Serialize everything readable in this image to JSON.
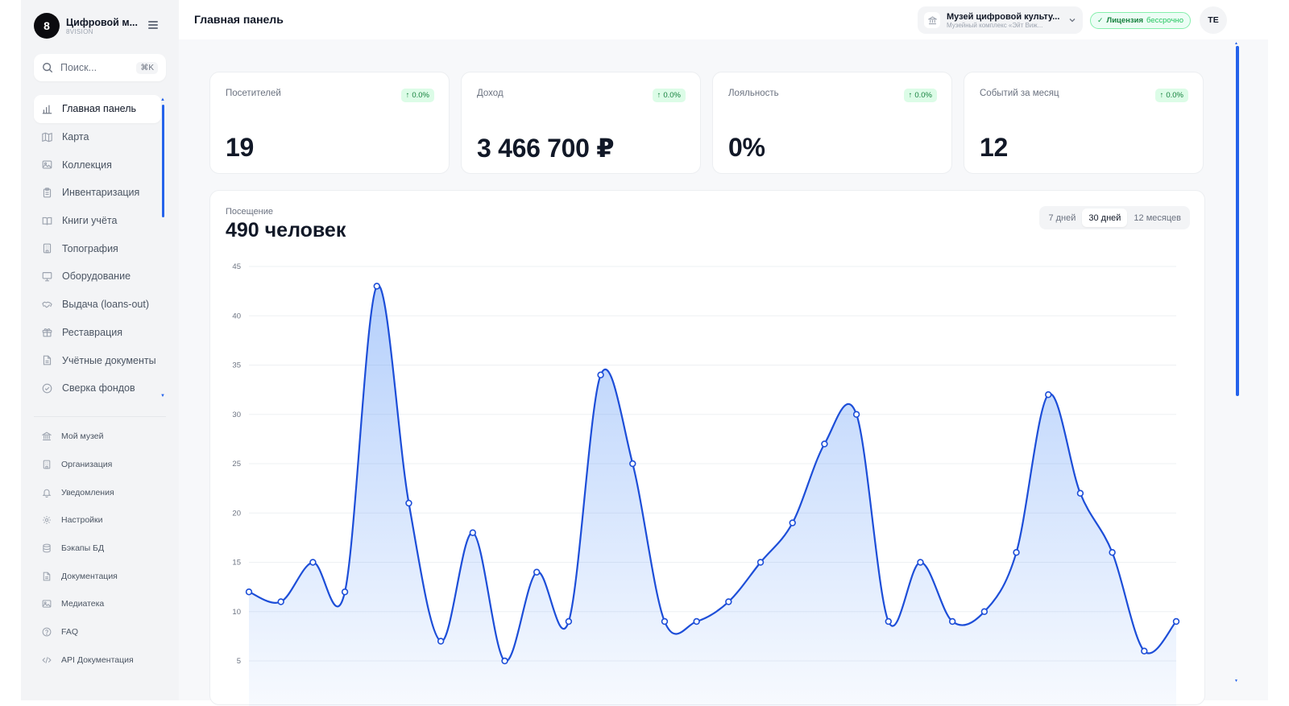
{
  "brand": {
    "logo": "8",
    "name": "Цифровой м...",
    "sub": "8VISION"
  },
  "search": {
    "placeholder": "Поиск...",
    "shortcut": "⌘K"
  },
  "nav": {
    "items": [
      {
        "label": "Главная панель",
        "icon": "bar-chart-icon",
        "active": true
      },
      {
        "label": "Карта",
        "icon": "map-icon"
      },
      {
        "label": "Коллекция",
        "icon": "image-icon"
      },
      {
        "label": "Инвентаризация",
        "icon": "clipboard-icon"
      },
      {
        "label": "Книги учёта",
        "icon": "book-icon"
      },
      {
        "label": "Топография",
        "icon": "building-icon"
      },
      {
        "label": "Оборудование",
        "icon": "monitor-icon"
      },
      {
        "label": "Выдача (loans-out)",
        "icon": "handshake-icon"
      },
      {
        "label": "Реставрация",
        "icon": "gift-icon"
      },
      {
        "label": "Учётные документы",
        "icon": "file-icon"
      },
      {
        "label": "Сверка фондов",
        "icon": "check-circle-icon"
      }
    ],
    "secondary": [
      {
        "label": "Мой музей",
        "icon": "museum-icon"
      },
      {
        "label": "Организация",
        "icon": "building-icon"
      },
      {
        "label": "Уведомления",
        "icon": "bell-icon"
      },
      {
        "label": "Настройки",
        "icon": "gear-icon"
      },
      {
        "label": "Бэкапы БД",
        "icon": "database-icon"
      },
      {
        "label": "Документация",
        "icon": "file-icon"
      },
      {
        "label": "Медиатека",
        "icon": "image-icon"
      },
      {
        "label": "FAQ",
        "icon": "help-circle-icon"
      },
      {
        "label": "API Документация",
        "icon": "code-icon"
      }
    ]
  },
  "header": {
    "title": "Главная панель",
    "museum_name": "Музей цифровой культу...",
    "museum_sub": "Музейный комплекс «Эйт Виж...",
    "license_label": "Лицензия",
    "license_term": "бессрочно",
    "avatar": "TE"
  },
  "stats": [
    {
      "label": "Посетителей",
      "change": "0.0%",
      "value": "19"
    },
    {
      "label": "Доход",
      "change": "0.0%",
      "value": "3 466 700 ₽"
    },
    {
      "label": "Лояльность",
      "change": "0.0%",
      "value": "0%"
    },
    {
      "label": "Событий за месяц",
      "change": "0.0%",
      "value": "12"
    }
  ],
  "visits": {
    "label": "Посещение",
    "total": "490 человек",
    "ranges": [
      "7 дней",
      "30 дней",
      "12 месяцев"
    ],
    "active_range": "30 дней"
  },
  "colors": {
    "accent": "#2563eb",
    "line": "#1d4ed8",
    "positive": "#15803d"
  },
  "chart_data": {
    "type": "area",
    "title": "",
    "xlabel": "",
    "ylabel": "",
    "ylim": [
      0,
      45
    ],
    "yticks": [
      5,
      10,
      15,
      20,
      25,
      30,
      35,
      40,
      45
    ],
    "grid": true,
    "legend": "none",
    "series": [
      {
        "values": [
          12,
          11,
          15,
          12,
          43,
          21,
          7,
          18,
          5,
          14,
          9,
          34,
          25,
          9,
          9,
          11,
          15,
          19,
          27,
          30,
          9,
          15,
          9,
          10,
          16,
          32,
          22,
          16,
          6,
          9
        ]
      }
    ]
  }
}
